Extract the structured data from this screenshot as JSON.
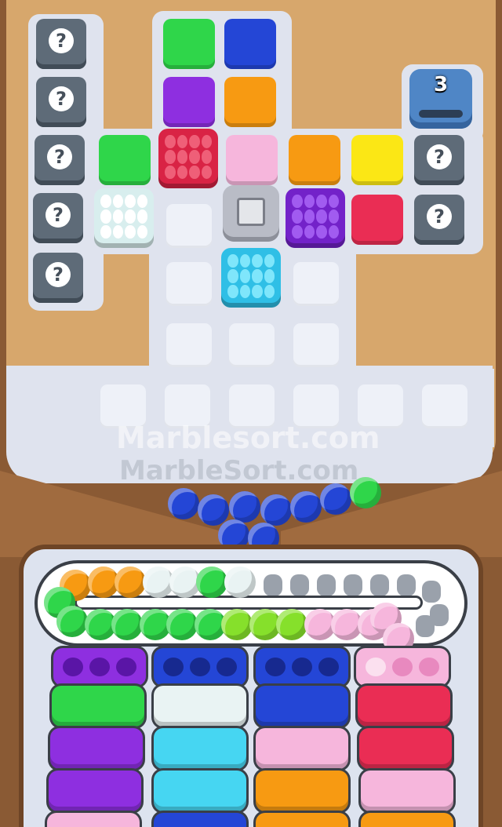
{
  "game": {
    "watermark_primary": "Marblesort.com",
    "watermark_secondary": "MarbleSort.com",
    "mystery_label": "?",
    "locked_counter": "3"
  },
  "colors": {
    "green": "#2fd64a",
    "blue": "#2446d6",
    "purple": "#8e2fe0",
    "orange": "#f79a12",
    "pink": "#f6b6dc",
    "yellow": "#fbe715",
    "red": "#ea2d54",
    "white": "#e9f3f3",
    "cyan": "#46d6f2",
    "mystery": "#5e6b78"
  },
  "conveyor": {
    "capacity_slots": 30,
    "marbles": [
      "orange",
      "orange",
      "orange",
      "white",
      "white",
      "green",
      "white",
      "green",
      "green",
      "green",
      "green",
      "green",
      "green",
      "green",
      "lightgreen",
      "lightgreen",
      "lightgreen",
      "pink",
      "pink",
      "pink",
      "pink",
      "pink"
    ]
  },
  "tubes": [
    {
      "column": 1,
      "colors": [
        "purple",
        "green",
        "purple",
        "purple"
      ]
    },
    {
      "column": 2,
      "colors": [
        "blue",
        "white",
        "cyan",
        "cyan"
      ]
    },
    {
      "column": 3,
      "colors": [
        "blue",
        "blue",
        "pink",
        "orange"
      ]
    },
    {
      "column": 4,
      "colors": [
        "pink",
        "red",
        "red",
        "pink"
      ]
    }
  ]
}
